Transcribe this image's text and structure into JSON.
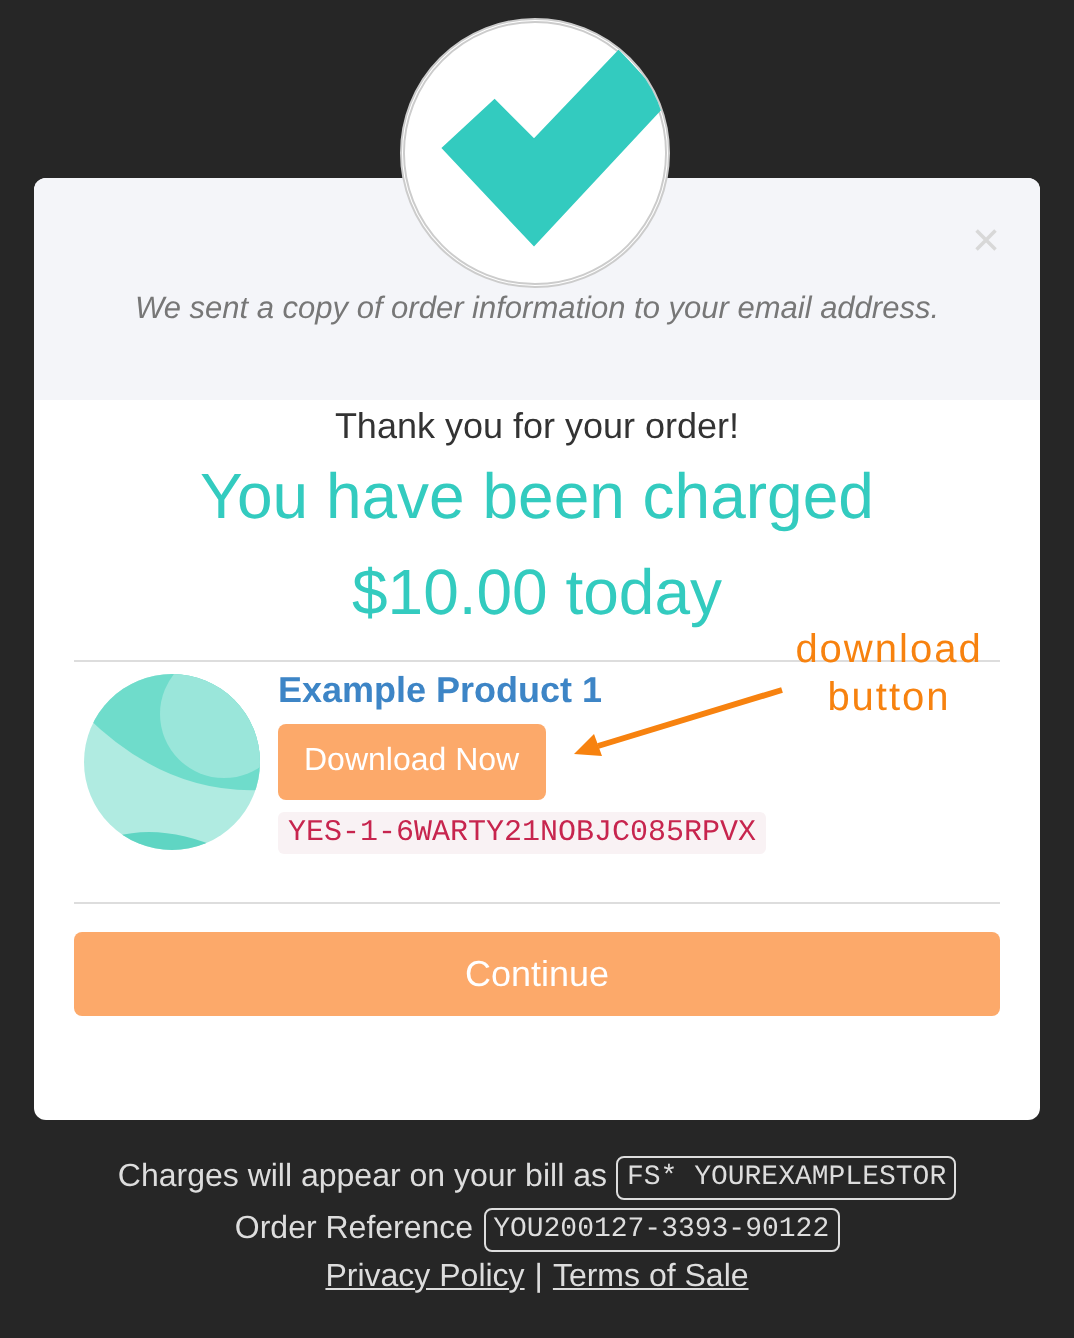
{
  "modal": {
    "close": "×",
    "notice": "We sent a copy of order information to your email address.",
    "thanks": "Thank you for your order!",
    "charged_line_1": "You have been charged",
    "charged_line_2": "$10.00 today",
    "products": [
      {
        "name": "Example Product 1",
        "button": "Download Now",
        "license": "YES-1-6WARTY21NOBJC085RPVX"
      }
    ],
    "annotation": "download button",
    "continue": "Continue"
  },
  "footer": {
    "bill_label": "Charges will appear on your bill as",
    "bill_value": "FS* YOUREXAMPLESTOR",
    "ref_label": "Order Reference",
    "ref_value": "YOU200127-3393-90122",
    "links": [
      "Privacy Policy",
      "Terms of Sale"
    ],
    "separator": "|"
  }
}
